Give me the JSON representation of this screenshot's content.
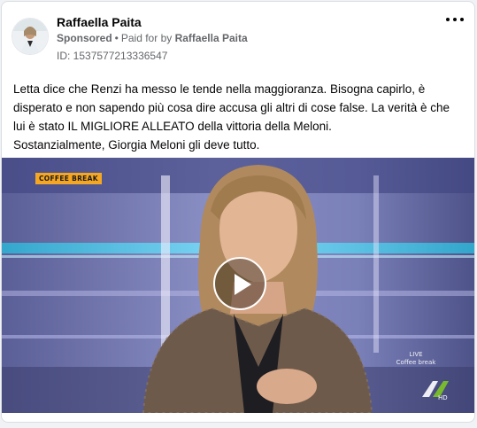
{
  "post": {
    "author": "Raffaella Paita",
    "sponsored_label": "Sponsored",
    "paid_for_prefix": "Paid for by",
    "paid_for_name": "Raffaella Paita",
    "ad_id": "ID: 1537577213336547",
    "text_lines": [
      "Letta dice che Renzi ha messo le tende nella maggioranza. Bisogna capirlo, è disperato e non sapendo più cosa dire accusa gli altri di cose false. La verità è che lui è stato IL MIGLIORE ALLEATO della vittoria della Meloni.",
      "Sostanzialmente, Giorgia Meloni gli deve tutto."
    ]
  },
  "video": {
    "badge": "COFFEE BREAK",
    "live_line1": "LIVE",
    "live_line2": "Coffee break",
    "logo_text": "LA7 HD"
  },
  "icons": {
    "more": "more-horizontal-icon",
    "play": "play-icon"
  },
  "colors": {
    "text_primary": "#050505",
    "text_secondary": "#65676b",
    "badge_bg": "#f5a623",
    "logo_green": "#7bbf2a"
  }
}
